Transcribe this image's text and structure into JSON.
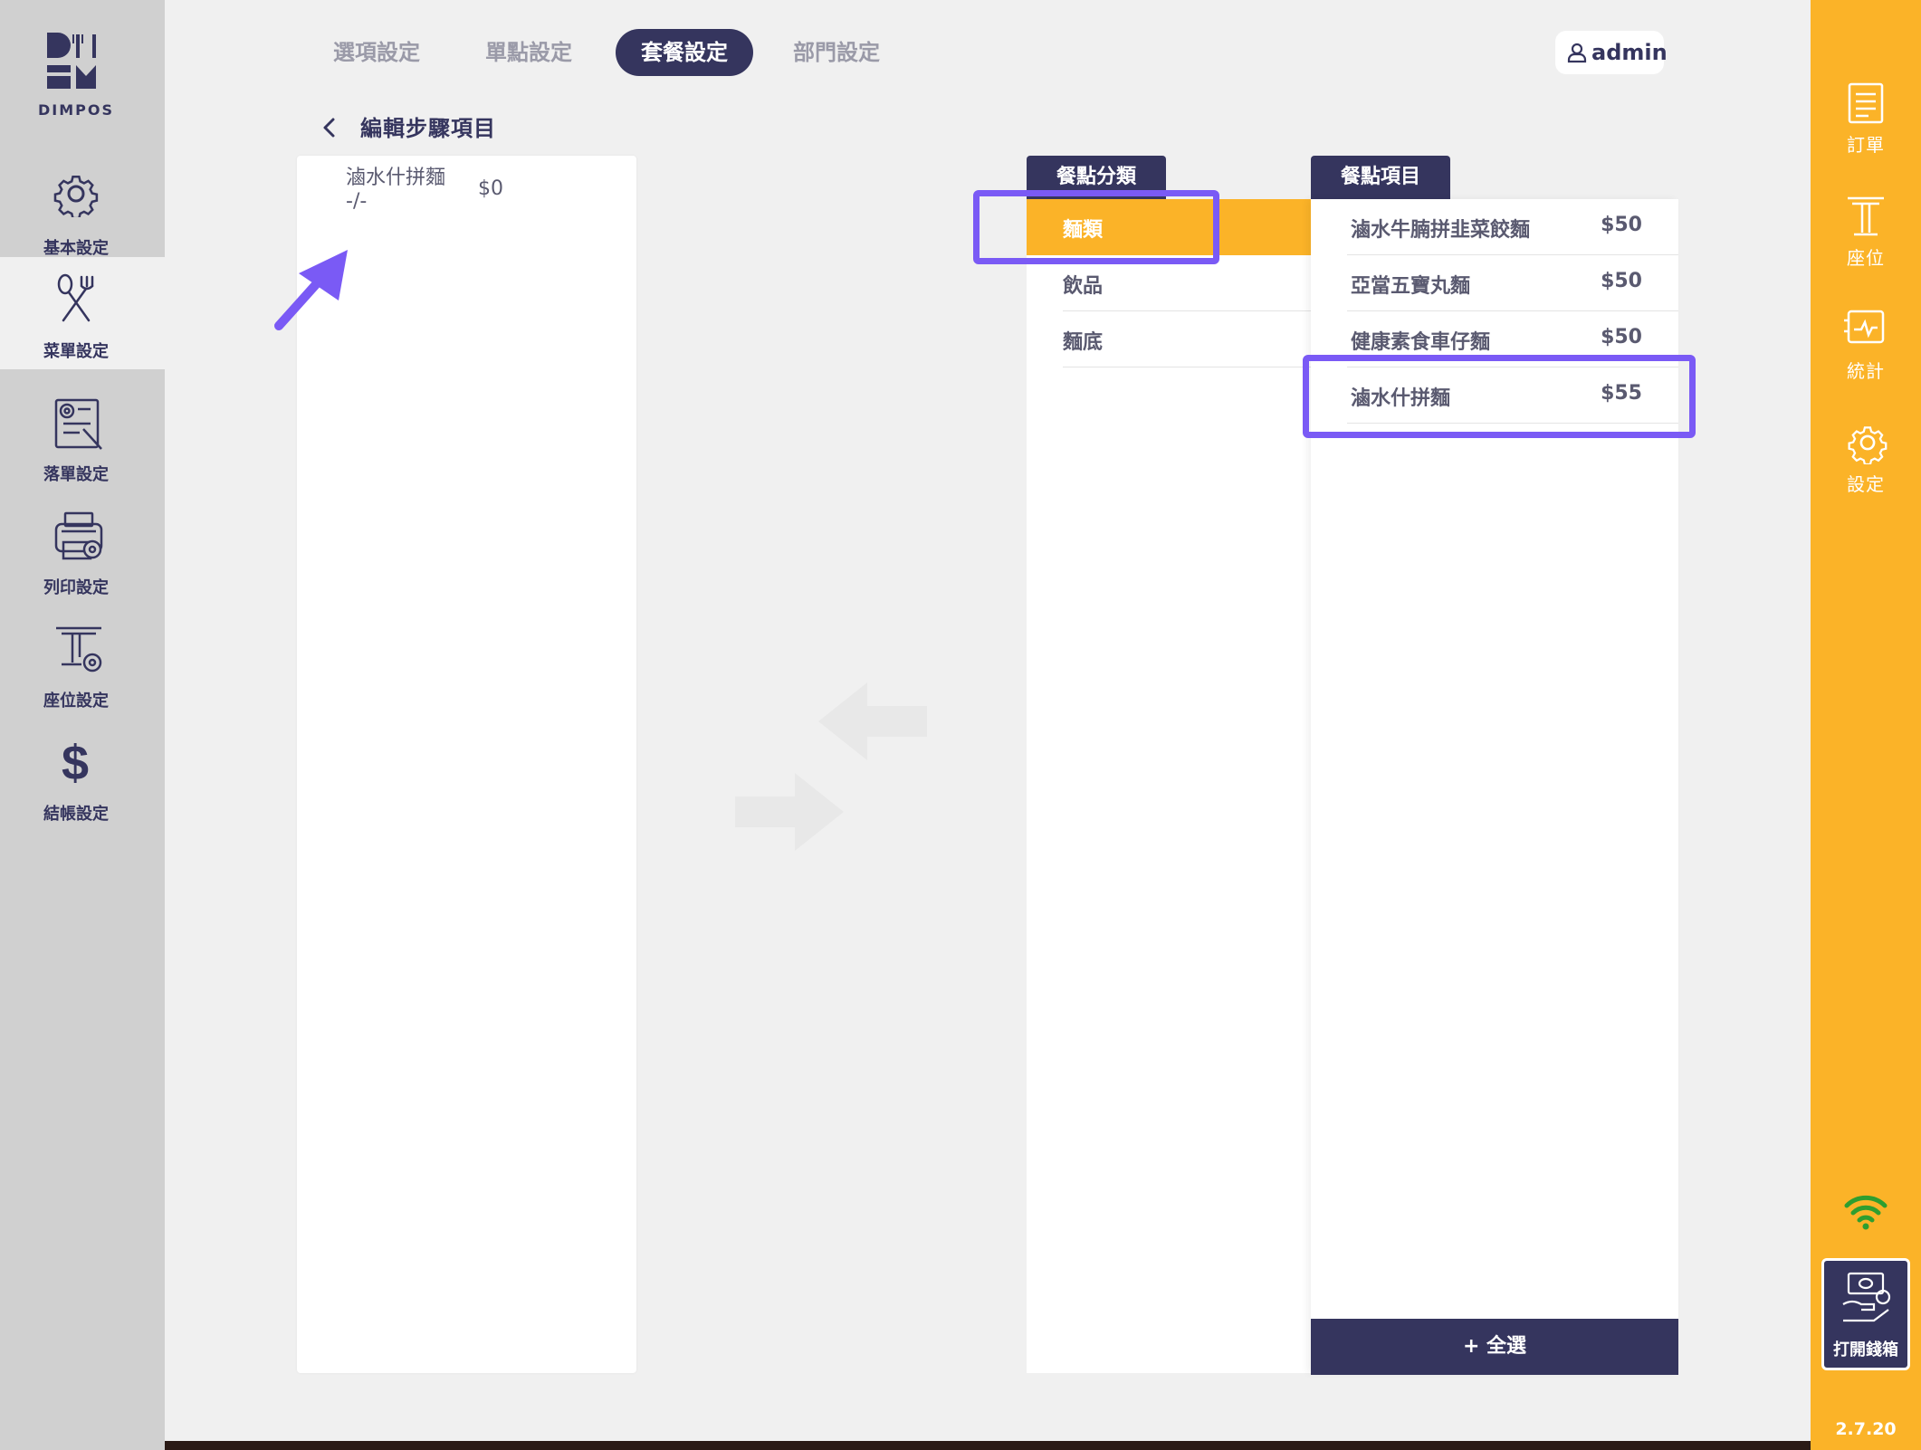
{
  "brand": {
    "name": "DIMPOS",
    "color_primary": "#35355e",
    "color_accent": "#fbb328",
    "color_highlight": "#7a5af5"
  },
  "left_nav": [
    {
      "label": "基本設定",
      "icon": "gear-icon"
    },
    {
      "label": "菜單設定",
      "icon": "utensils-icon"
    },
    {
      "label": "落單設定",
      "icon": "order-settings-icon"
    },
    {
      "label": "列印設定",
      "icon": "printer-icon"
    },
    {
      "label": "座位設定",
      "icon": "seat-icon"
    },
    {
      "label": "結帳設定",
      "icon": "dollar-icon"
    }
  ],
  "tabs": [
    {
      "label": "選項設定"
    },
    {
      "label": "單點設定"
    },
    {
      "label": "套餐設定"
    },
    {
      "label": "部門設定"
    }
  ],
  "user": {
    "name": "admin"
  },
  "page": {
    "title": "編輯步驟項目"
  },
  "selected_items": [
    {
      "name": "滷水什拼麵",
      "sub": "-/-",
      "price": "$0"
    }
  ],
  "categories": {
    "header": "餐點分類",
    "items": [
      {
        "label": "麵類"
      },
      {
        "label": "飲品"
      },
      {
        "label": "麵底"
      }
    ]
  },
  "menu_items": {
    "header": "餐點項目",
    "items": [
      {
        "name": "滷水牛腩拼韭菜餃麵",
        "price": "$50"
      },
      {
        "name": "亞當五寶丸麵",
        "price": "$50"
      },
      {
        "name": "健康素食車仔麵",
        "price": "$50"
      },
      {
        "name": "滷水什拼麵",
        "price": "$55"
      }
    ],
    "select_all": "+ 全選"
  },
  "right_nav": [
    {
      "label": "訂單",
      "icon": "receipt-icon"
    },
    {
      "label": "座位",
      "icon": "table-icon"
    },
    {
      "label": "統計",
      "icon": "stats-icon"
    },
    {
      "label": "設定",
      "icon": "gear-icon"
    }
  ],
  "cash_drawer": {
    "label": "打開錢箱"
  },
  "version": "2.7.20"
}
